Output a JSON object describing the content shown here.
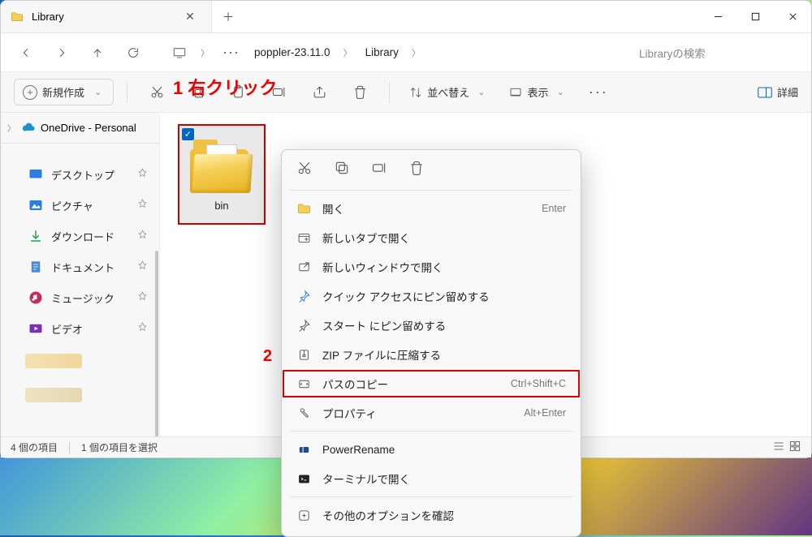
{
  "tab": {
    "title": "Library"
  },
  "breadcrumb": {
    "seg1": "poppler-23.11.0",
    "seg2": "Library"
  },
  "search": {
    "placeholder": "Libraryの検索"
  },
  "toolbar": {
    "new_label": "新規作成",
    "sort_label": "並べ替え",
    "view_label": "表示",
    "detail_label": "詳細"
  },
  "nav": {
    "onedrive": "OneDrive - Personal",
    "items": [
      {
        "label": "デスクトップ"
      },
      {
        "label": "ピクチャ"
      },
      {
        "label": "ダウンロード"
      },
      {
        "label": "ドキュメント"
      },
      {
        "label": "ミュージック"
      },
      {
        "label": "ビデオ"
      }
    ]
  },
  "folder": {
    "name": "bin"
  },
  "status": {
    "count": "4 個の項目",
    "selected": "1 個の項目を選択"
  },
  "annotations": {
    "a1": "1 右クリック",
    "a2": "2"
  },
  "ctx": {
    "open": "開く",
    "open_sc": "Enter",
    "newtab": "新しいタブで開く",
    "newwin": "新しいウィンドウで開く",
    "pinqa": "クイック アクセスにピン留めする",
    "pinstart": "スタート にピン留めする",
    "zip": "ZIP ファイルに圧縮する",
    "copypath": "パスのコピー",
    "copypath_sc": "Ctrl+Shift+C",
    "prop": "プロパティ",
    "prop_sc": "Alt+Enter",
    "powerrename": "PowerRename",
    "terminal": "ターミナルで開く",
    "more": "その他のオプションを確認"
  }
}
